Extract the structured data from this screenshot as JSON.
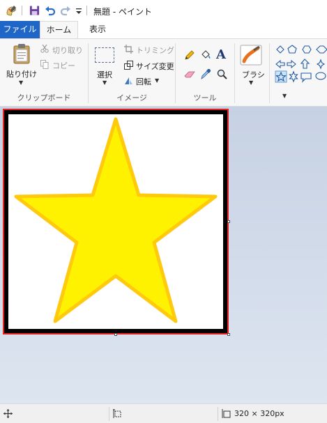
{
  "window": {
    "title": "無題 - ペイント"
  },
  "tabs": [
    {
      "label": "ファイル"
    },
    {
      "label": "ホーム"
    },
    {
      "label": "表示"
    }
  ],
  "ribbon": {
    "clipboard": {
      "paste": "貼り付け",
      "cut": "切り取り",
      "copy": "コピー",
      "group": "クリップボード"
    },
    "image": {
      "select": "選択",
      "crop": "トリミング",
      "resize": "サイズ変更",
      "rotate": "回転",
      "group": "イメージ"
    },
    "tools": {
      "group": "ツール",
      "text_glyph": "A"
    },
    "brushes": {
      "label": "ブラシ"
    }
  },
  "canvas": {
    "star_fill": "#fff200",
    "star_stroke": "#ffc90e",
    "border_color": "#000000",
    "selection_color": "#e8201f"
  },
  "status": {
    "size_text": "320 × 320px"
  }
}
